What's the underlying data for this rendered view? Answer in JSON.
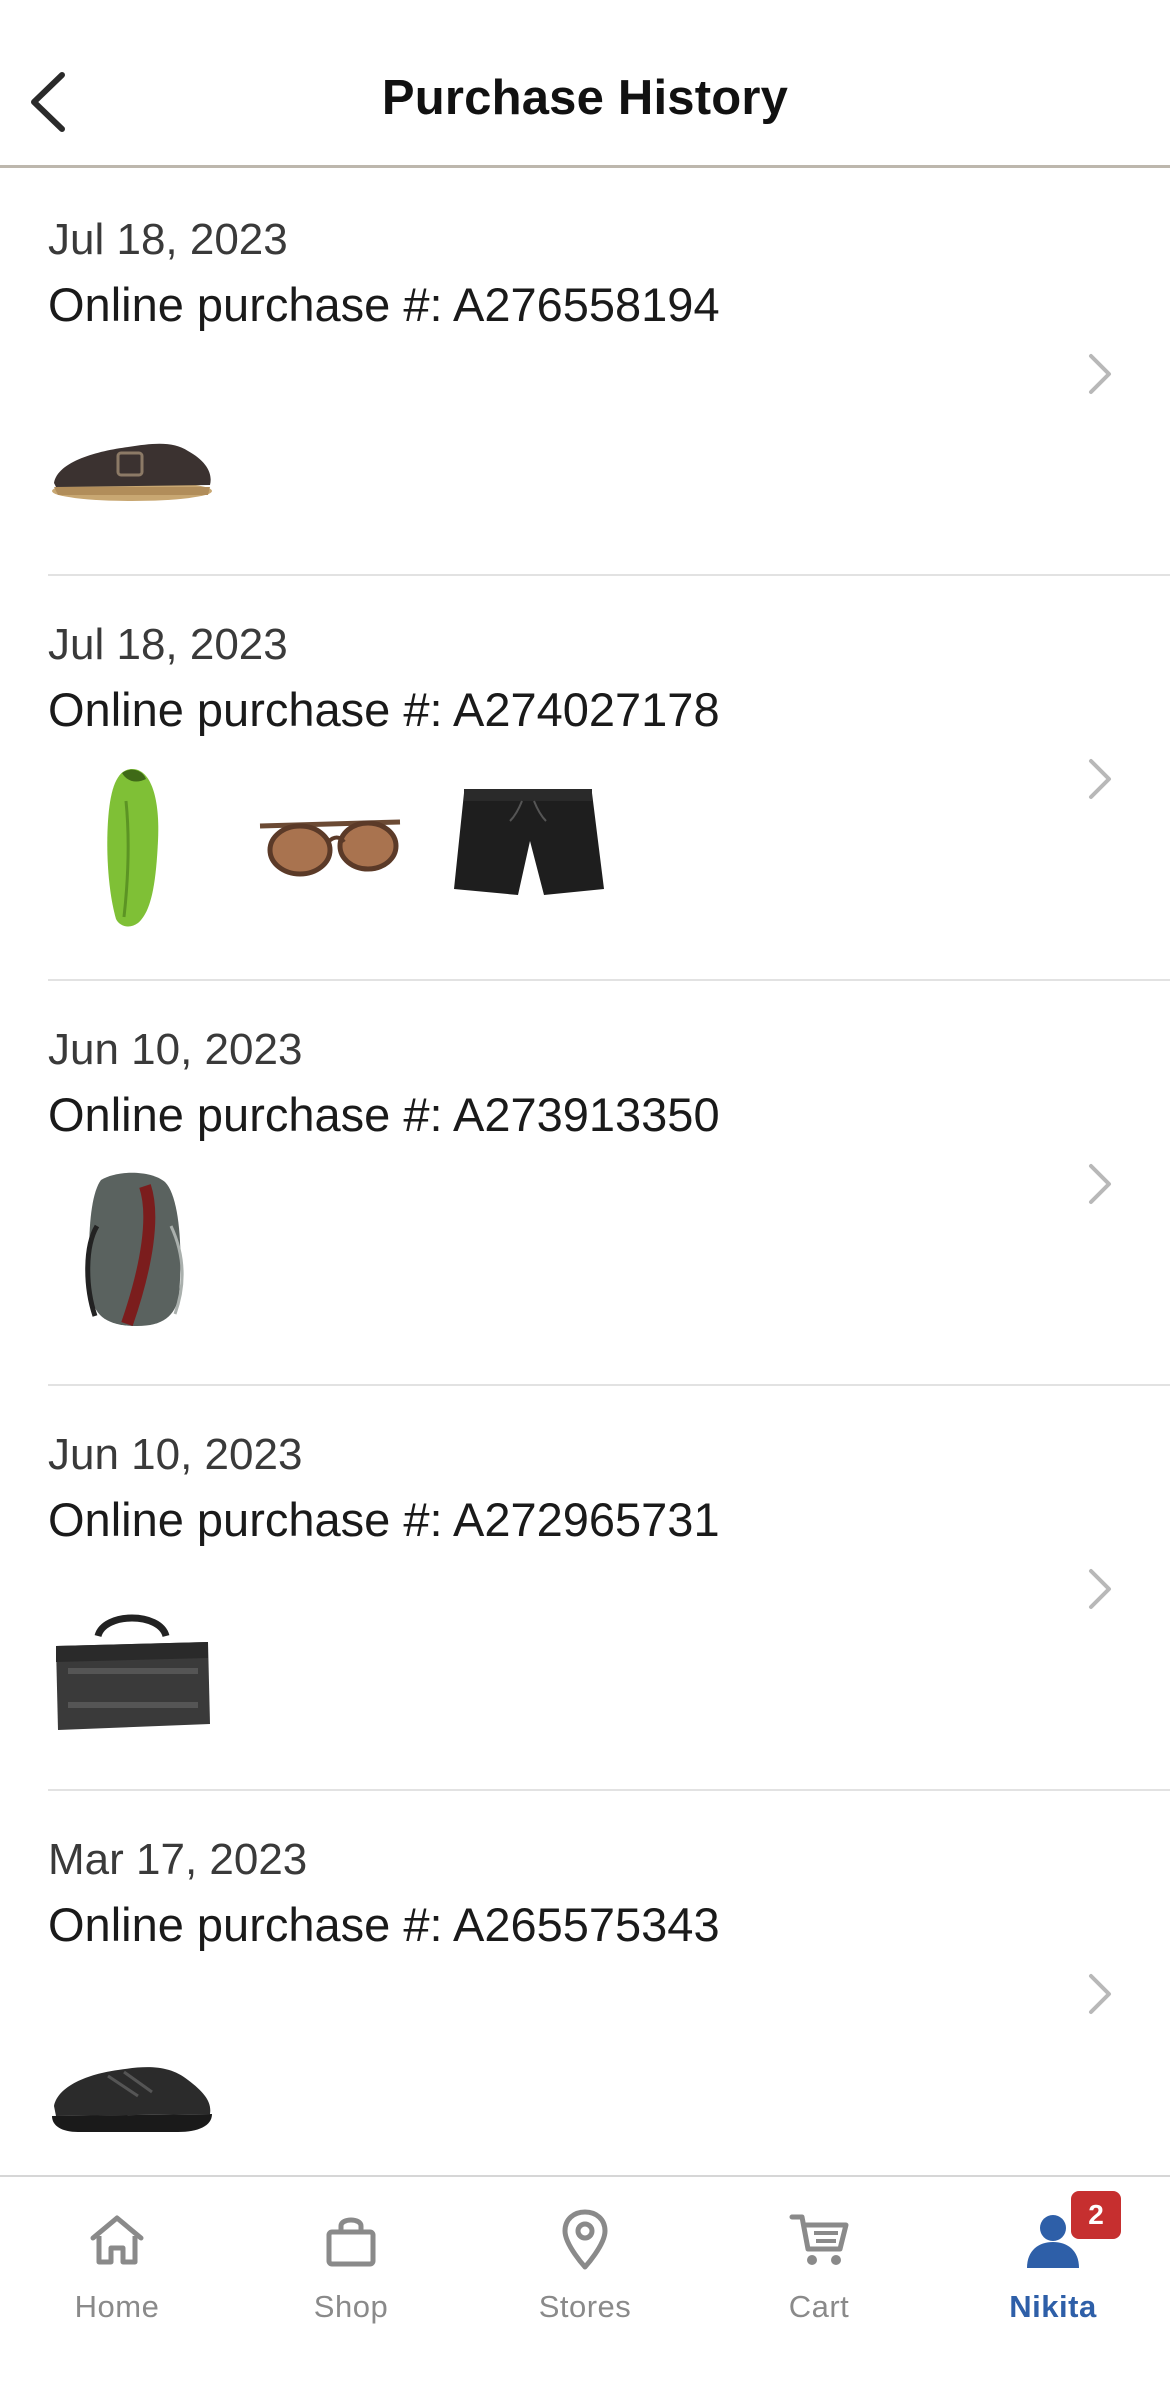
{
  "header": {
    "title": "Purchase History",
    "back_icon": "chevron-left-icon"
  },
  "orders": [
    {
      "date": "Jul 18, 2023",
      "number": "Online purchase #: A276558194",
      "items": [
        "clog-shoe"
      ]
    },
    {
      "date": "Jul 18, 2023",
      "number": "Online purchase #: A274027178",
      "items": [
        "sleeping-bag",
        "sunglasses",
        "shorts"
      ]
    },
    {
      "date": "Jun 10, 2023",
      "number": "Online purchase #: A273913350",
      "items": [
        "backpack"
      ]
    },
    {
      "date": "Jun 10, 2023",
      "number": "Online purchase #: A272965731",
      "items": [
        "duffel-bag"
      ]
    },
    {
      "date": "Mar 17, 2023",
      "number": "Online purchase #: A265575343",
      "items": [
        "running-shoe"
      ]
    }
  ],
  "tabbar": {
    "tabs": [
      {
        "label": "Home",
        "icon": "home-icon"
      },
      {
        "label": "Shop",
        "icon": "shopping-bag-icon"
      },
      {
        "label": "Stores",
        "icon": "location-pin-icon"
      },
      {
        "label": "Cart",
        "icon": "cart-icon"
      },
      {
        "label": "Nikita",
        "icon": "user-icon",
        "active": true,
        "badge": "2"
      }
    ]
  },
  "colors": {
    "accent": "#2e5fa8",
    "badge": "#c62f2f",
    "inactive_tab": "#8a8a8a"
  }
}
